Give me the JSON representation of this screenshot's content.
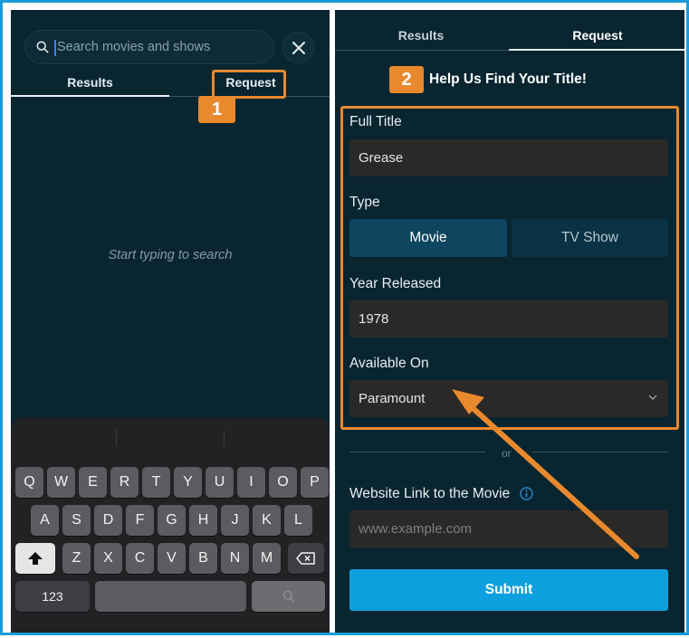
{
  "left": {
    "search": {
      "placeholder": "Search movies and shows"
    },
    "tabs": [
      {
        "label": "Results"
      },
      {
        "label": "Request"
      }
    ],
    "empty_message": "Start typing to search",
    "keyboard": {
      "row1": [
        "Q",
        "W",
        "E",
        "R",
        "T",
        "Y",
        "U",
        "I",
        "O",
        "P"
      ],
      "row2": [
        "A",
        "S",
        "D",
        "F",
        "G",
        "H",
        "J",
        "K",
        "L"
      ],
      "row3": [
        "Z",
        "X",
        "C",
        "V",
        "B",
        "N",
        "M"
      ],
      "numbers_key": "123"
    }
  },
  "annotations": {
    "step1": "1",
    "step2": "2",
    "accent": "#e8892e"
  },
  "right": {
    "tabs": [
      {
        "label": "Results"
      },
      {
        "label": "Request"
      }
    ],
    "heading": "Help Us Find Your Title!",
    "form": {
      "full_title_label": "Full Title",
      "full_title_value": "Grease",
      "type_label": "Type",
      "type_options": [
        {
          "label": "Movie",
          "selected": true
        },
        {
          "label": "TV Show",
          "selected": false
        }
      ],
      "year_label": "Year Released",
      "year_value": "1978",
      "available_label": "Available On",
      "available_value": "Paramount",
      "or_text": "or",
      "website_label": "Website Link to the Movie",
      "website_placeholder": "www.example.com",
      "submit_label": "Submit"
    }
  },
  "colors": {
    "background": "#082530",
    "frame": "#1a9bd7",
    "submit": "#0ca1de",
    "selected_type": "#0e4660"
  }
}
